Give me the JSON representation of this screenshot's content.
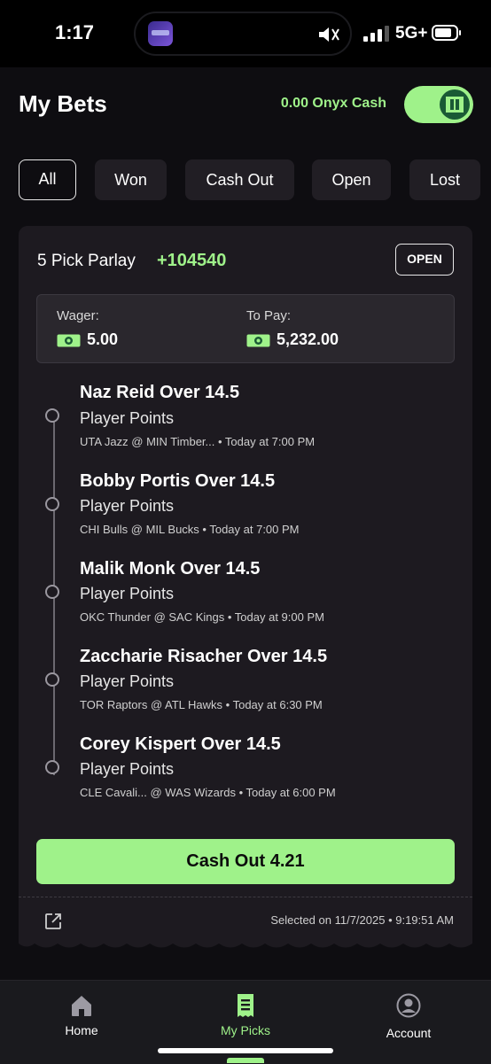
{
  "status_bar": {
    "time": "1:17",
    "network": "5G+"
  },
  "header": {
    "title": "My Bets",
    "balance_label": "0.00 Onyx Cash"
  },
  "filters": [
    {
      "label": "All",
      "active": true
    },
    {
      "label": "Won",
      "active": false
    },
    {
      "label": "Cash Out",
      "active": false
    },
    {
      "label": "Open",
      "active": false
    },
    {
      "label": "Lost",
      "active": false
    }
  ],
  "bet": {
    "title": "5 Pick Parlay",
    "odds": "+104540",
    "status": "OPEN",
    "wager_label": "Wager:",
    "wager_value": "5.00",
    "to_pay_label": "To Pay:",
    "to_pay_value": "5,232.00",
    "picks": [
      {
        "title": "Naz Reid Over 14.5",
        "market": "Player Points",
        "meta": "UTA Jazz @ MIN Timber... • Today at 7:00 PM"
      },
      {
        "title": "Bobby Portis Over 14.5",
        "market": "Player Points",
        "meta": "CHI Bulls @ MIL Bucks • Today at 7:00 PM"
      },
      {
        "title": "Malik Monk Over 14.5",
        "market": "Player Points",
        "meta": "OKC Thunder @ SAC Kings • Today at 9:00 PM"
      },
      {
        "title": "Zaccharie Risacher Over 14.5",
        "market": "Player Points",
        "meta": "TOR Raptors @ ATL Hawks • Today at 6:30 PM"
      },
      {
        "title": "Corey Kispert Over 14.5",
        "market": "Player Points",
        "meta": "CLE Cavali... @ WAS Wizards • Today at 6:00 PM"
      }
    ],
    "cash_out_label": "Cash Out 4.21",
    "selected_on": "Selected on 11/7/2025 • 9:19:51 AM"
  },
  "tabbar": {
    "items": [
      {
        "label": "Home",
        "icon": "home-icon",
        "active": false
      },
      {
        "label": "My Picks",
        "icon": "ticket-icon",
        "active": true
      },
      {
        "label": "Account",
        "icon": "account-icon",
        "active": false
      }
    ]
  },
  "colors": {
    "accent": "#9ff28a",
    "background": "#0e0d11",
    "card": "#1d1a20"
  }
}
